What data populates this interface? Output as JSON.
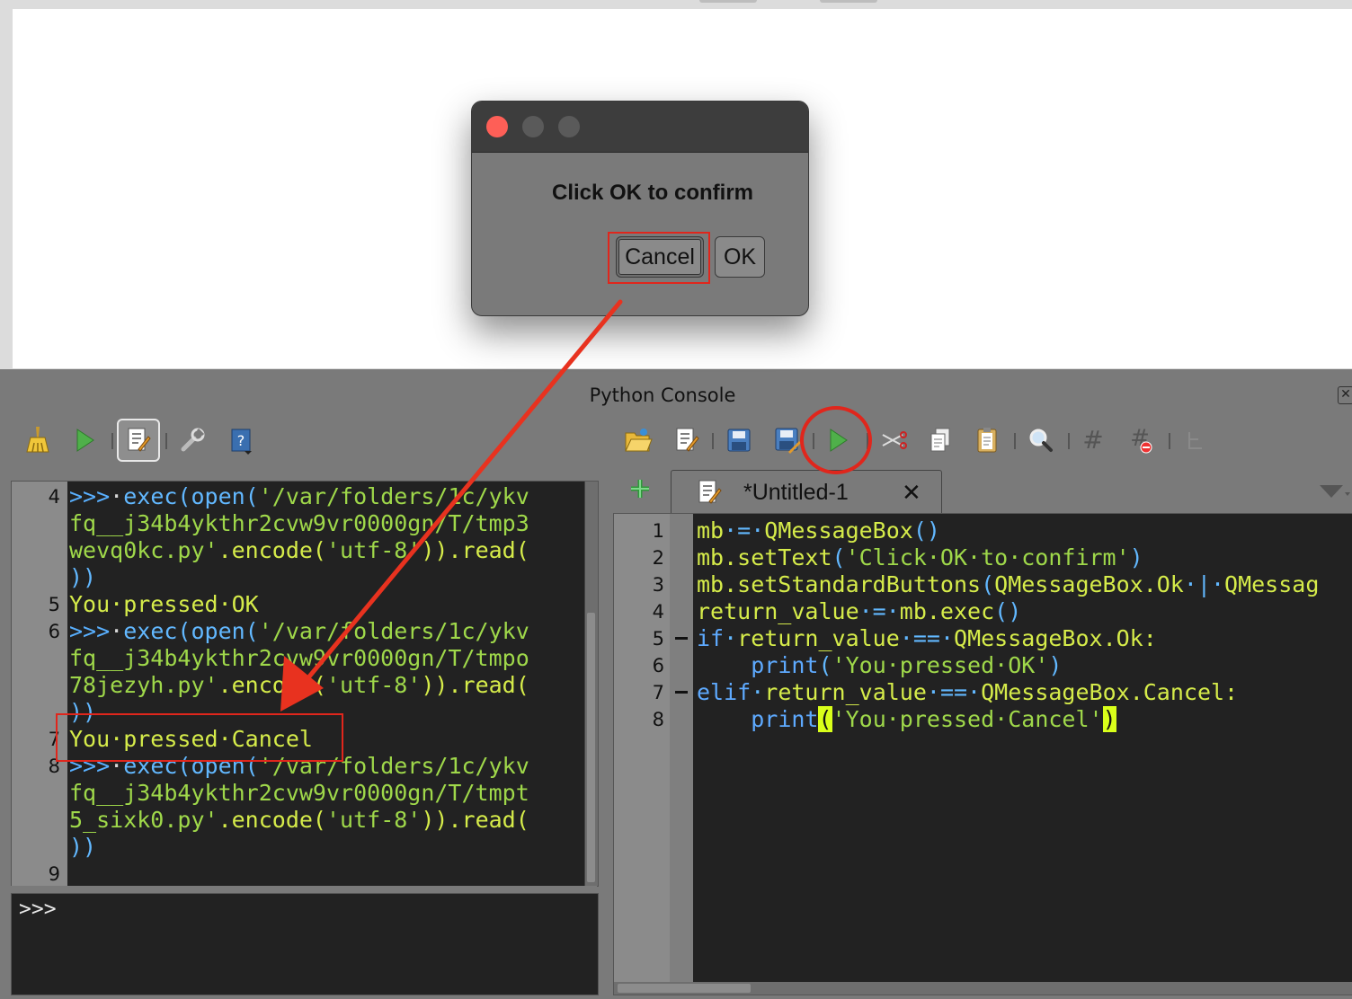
{
  "dialog": {
    "message": "Click OK to confirm",
    "cancel_label": "Cancel",
    "ok_label": "OK"
  },
  "panel": {
    "title": "Python Console",
    "close_glyph": "✕"
  },
  "console": {
    "line_numbers": [
      "4",
      "5",
      "6",
      "7",
      "8",
      "9"
    ],
    "lines": [
      {
        "prompt": ">>>",
        "func": "exec(open(",
        "str": "'/var/folders/1c/ykv"
      },
      {
        "str": "fq__j34b4ykthr2cvw9vr0000gn/T/tmp3"
      },
      {
        "str": "wevq0kc.py'",
        "func": ".encode(",
        "str2": "'utf-8'",
        "tail": ")).read("
      },
      {
        "tail": "))"
      },
      {
        "out": "You pressed OK"
      },
      {
        "prompt": ">>>",
        "func": "exec(open(",
        "str": "'/var/folders/1c/ykv"
      },
      {
        "str": "fq__j34b4ykthr2cvw9vr0000gn/T/tmpo"
      },
      {
        "str": "78jezyh.py'",
        "func": ".encode(",
        "str2": "'utf-8'",
        "tail": ")).read("
      },
      {
        "tail": "))"
      },
      {
        "out": "You pressed Cancel"
      },
      {
        "prompt": ">>>",
        "func": "exec(open(",
        "str": "'/var/folders/1c/ykv"
      },
      {
        "str": "fq__j34b4ykthr2cvw9vr0000gn/T/tmpt"
      },
      {
        "str": "5_sixk0.py'",
        "func": ".encode(",
        "str2": "'utf-8'",
        "tail": ")).read("
      },
      {
        "tail": "))"
      }
    ],
    "input_prompt": ">>>"
  },
  "toolbar_left": [
    "clear-console",
    "run-command",
    "show-editor",
    "settings",
    "help"
  ],
  "toolbar_right": [
    "open-script",
    "open-in-external-editor",
    "save",
    "save-as",
    "run-script",
    "cut",
    "copy",
    "paste",
    "find",
    "comment",
    "uncomment",
    "object-inspector"
  ],
  "editor": {
    "tab_label": "*Untitled-1",
    "tab_close": "✕",
    "line_numbers": [
      "1",
      "2",
      "3",
      "4",
      "5",
      "6",
      "7",
      "8"
    ],
    "lines": [
      "mb = QMessageBox()",
      "mb.setText('Click OK to confirm')",
      "mb.setStandardButtons(QMessageBox.Ok | QMessag",
      "return_value = mb.exec()",
      "if return_value == QMessageBox.Ok:",
      "    print('You pressed OK')",
      "elif return_value == QMessageBox.Cancel:",
      "    print('You pressed Cancel')"
    ]
  },
  "colors": {
    "annotation": "#e0261c",
    "bg_panel": "#7a7a7a",
    "code_bg": "#222222",
    "keyword": "#5eaaff",
    "string": "#9fd84a",
    "identifier": "#d6ec4a"
  }
}
